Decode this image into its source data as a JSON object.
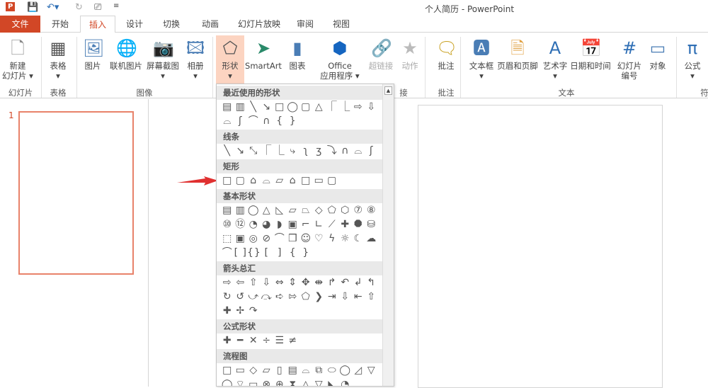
{
  "window": {
    "title": "个人简历 - PowerPoint",
    "app_icon": "P"
  },
  "quick_access": [
    "save-icon",
    "undo-icon",
    "redo-icon",
    "presenter-icon",
    "customize-icon"
  ],
  "tabs": [
    {
      "label": "文件"
    },
    {
      "label": "开始"
    },
    {
      "label": "插入"
    },
    {
      "label": "设计"
    },
    {
      "label": "切换"
    },
    {
      "label": "动画"
    },
    {
      "label": "幻灯片放映"
    },
    {
      "label": "审阅"
    },
    {
      "label": "视图"
    }
  ],
  "active_tab": "插入",
  "ribbon": {
    "buttons": [
      {
        "label": "新建\n幻灯片 ▾",
        "icon": "new-slide-icon"
      },
      {
        "label": "表格\n▾",
        "icon": "table-icon"
      },
      {
        "label": "图片",
        "icon": "picture-icon"
      },
      {
        "label": "联机图片",
        "icon": "online-picture-icon"
      },
      {
        "label": "屏幕截图\n▾",
        "icon": "screenshot-icon"
      },
      {
        "label": "相册\n▾",
        "icon": "photo-album-icon"
      },
      {
        "label": "形状\n▾",
        "icon": "shapes-icon"
      },
      {
        "label": "SmartArt",
        "icon": "smartart-icon"
      },
      {
        "label": "图表",
        "icon": "chart-icon"
      },
      {
        "label": "Office\n应用程序 ▾",
        "icon": "office-apps-icon"
      },
      {
        "label": "超链接",
        "icon": "hyperlink-icon"
      },
      {
        "label": "动作",
        "icon": "action-icon"
      },
      {
        "label": "批注",
        "icon": "comment-icon"
      },
      {
        "label": "文本框\n▾",
        "icon": "textbox-icon"
      },
      {
        "label": "页眉和页脚",
        "icon": "header-footer-icon"
      },
      {
        "label": "艺术字\n▾",
        "icon": "wordart-icon"
      },
      {
        "label": "日期和时间",
        "icon": "datetime-icon"
      },
      {
        "label": "幻灯片\n编号",
        "icon": "slide-number-icon"
      },
      {
        "label": "对象",
        "icon": "object-icon"
      },
      {
        "label": "公式\n▾",
        "icon": "equation-icon"
      }
    ],
    "groups": [
      "幻灯片",
      "表格",
      "图像",
      "接",
      "批注",
      "文本",
      "符"
    ]
  },
  "slides": [
    {
      "number": "1"
    }
  ],
  "shapes_gallery": {
    "sections": [
      {
        "title": "最近使用的形状",
        "rows": [
          [
            "▤",
            "▥",
            "╲",
            "↘",
            "□",
            "◯",
            "▢",
            "△",
            "⎾",
            "⎿",
            "⇨",
            "⇩"
          ],
          [
            "⌓",
            "ʃ",
            "⌒",
            "∩",
            "{",
            "}"
          ]
        ]
      },
      {
        "title": "线条",
        "rows": [
          [
            "╲",
            "↘",
            "⤡",
            "⎾",
            "⎿",
            "⤷",
            "ʅ",
            "ʒ",
            "⤵",
            "∩",
            "⌓",
            "ʃ"
          ]
        ]
      },
      {
        "title": "矩形",
        "rows": [
          [
            "□",
            "▢",
            "⌂",
            "⌓",
            "▱",
            "⌂",
            "□",
            "▭",
            "▢"
          ]
        ]
      },
      {
        "title": "基本形状",
        "rows": [
          [
            "▤",
            "▥",
            "◯",
            "△",
            "◺",
            "▱",
            "⏢",
            "◇",
            "⬠",
            "⬡",
            "⑦",
            "⑧"
          ],
          [
            "⑩",
            "⑫",
            "◔",
            "◕",
            "◗",
            "▣",
            "⌐",
            "∟",
            "⟋",
            "✚",
            "⯃",
            "⛁"
          ],
          [
            "⬚",
            "▣",
            "◎",
            "⊘",
            "⌒",
            "❒",
            "☺",
            "♡",
            "ϟ",
            "☼",
            "☾",
            "☁"
          ],
          [
            "⌒",
            "[ ]",
            "{}",
            "[",
            "]",
            "{",
            "}"
          ]
        ]
      },
      {
        "title": "箭头总汇",
        "rows": [
          [
            "⇨",
            "⇦",
            "⇧",
            "⇩",
            "⇔",
            "⇕",
            "✥",
            "⇼",
            "↱",
            "↶",
            "↲",
            "↰"
          ],
          [
            "↻",
            "↺",
            "⤻",
            "⤼",
            "➪",
            "⇰",
            "⬠",
            "❯",
            "⇥",
            "⇩",
            "⇤",
            "⇧"
          ],
          [
            "✚",
            "✢",
            "↷"
          ]
        ]
      },
      {
        "title": "公式形状",
        "rows": [
          [
            "✚",
            "━",
            "✕",
            "÷",
            "☰",
            "≠"
          ]
        ]
      },
      {
        "title": "流程图",
        "rows": [
          [
            "□",
            "▭",
            "◇",
            "▱",
            "▯",
            "▤",
            "⌓",
            "⧉",
            "⬭",
            "◯",
            "◿",
            "▽"
          ],
          [
            "◯",
            "⌔",
            "▭",
            "⊗",
            "⊕",
            "⧗",
            "△",
            "▽",
            "◣",
            "◔"
          ]
        ]
      }
    ]
  },
  "colors": {
    "accent": "#d24726",
    "selected_button": "#fcd4c1",
    "thumb_border": "#e8826a",
    "arrow": "#e03030"
  }
}
